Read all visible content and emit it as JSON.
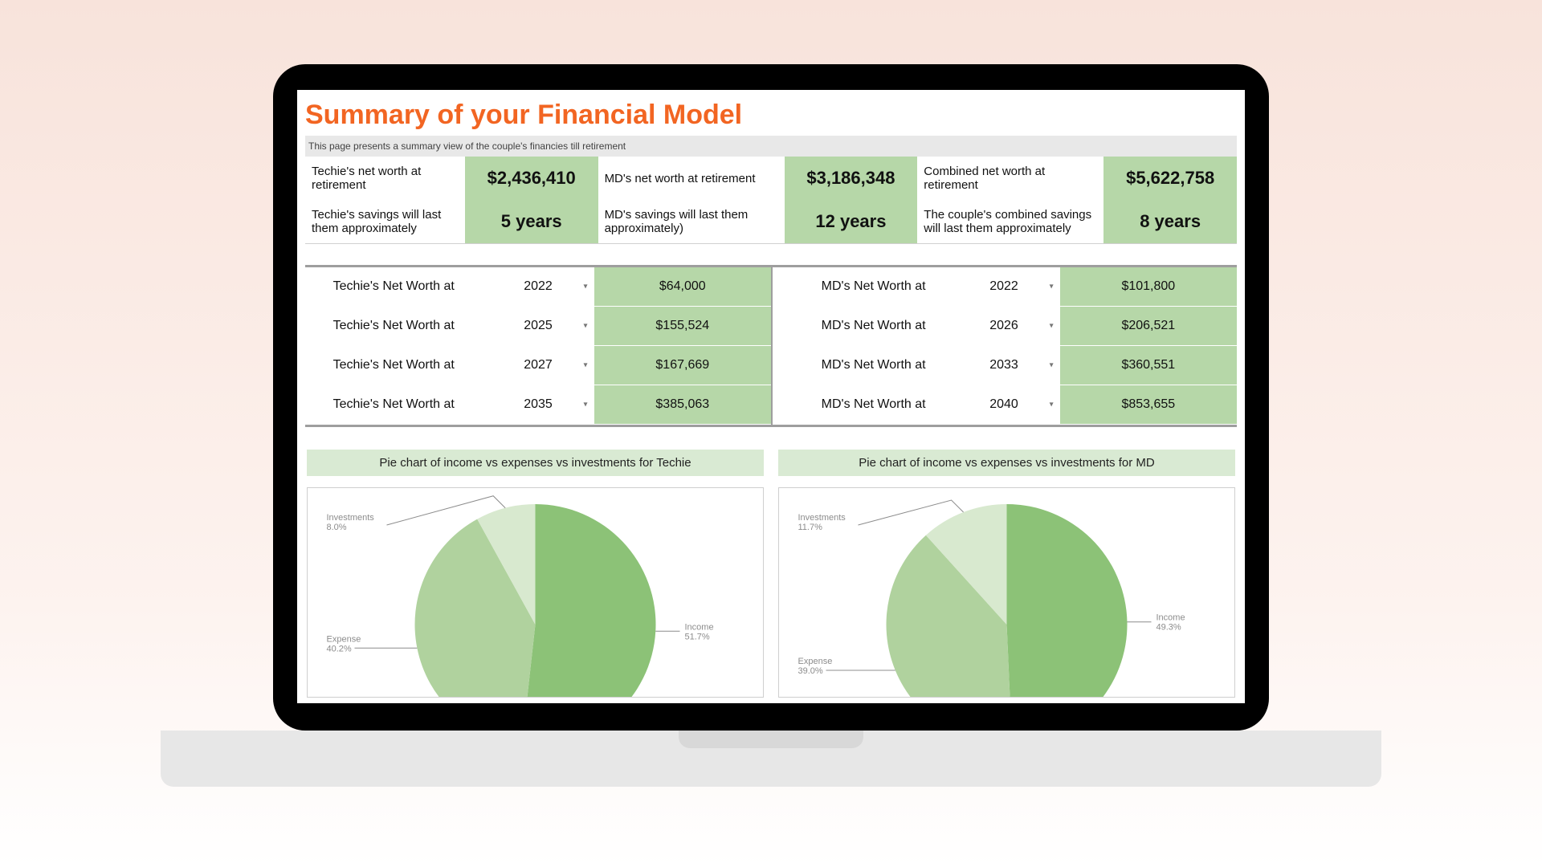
{
  "title": "Summary of your Financial Model",
  "subtitle": "This page presents a summary view of the couple's financies till retirement",
  "summary": {
    "r1": {
      "l1": "Techie's net worth at retirement",
      "v1": "$2,436,410",
      "l2": "MD's net worth at retirement",
      "v2": "$3,186,348",
      "l3": "Combined net worth at retirement",
      "v3": "$5,622,758"
    },
    "r2": {
      "l1": "Techie's savings will last them approximately",
      "v1": "5 years",
      "l2": "MD's savings will last them approximately)",
      "v2": "12 years",
      "l3": "The couple's combined savings will last them approximately",
      "v3": "8 years"
    }
  },
  "net_worth_rows": [
    {
      "left_label": "Techie's Net Worth at",
      "left_year": "2022",
      "left_amount": "$64,000",
      "right_label": "MD's Net Worth at",
      "right_year": "2022",
      "right_amount": "$101,800"
    },
    {
      "left_label": "Techie's Net Worth at",
      "left_year": "2025",
      "left_amount": "$155,524",
      "right_label": "MD's Net Worth at",
      "right_year": "2026",
      "right_amount": "$206,521"
    },
    {
      "left_label": "Techie's Net Worth at",
      "left_year": "2027",
      "left_amount": "$167,669",
      "right_label": "MD's Net Worth at",
      "right_year": "2033",
      "right_amount": "$360,551"
    },
    {
      "left_label": "Techie's Net Worth at",
      "left_year": "2035",
      "left_amount": "$385,063",
      "right_label": "MD's Net Worth at",
      "right_year": "2040",
      "right_amount": "$853,655"
    }
  ],
  "chart_left_title": "Pie chart of income vs expenses vs investments for Techie",
  "chart_right_title": "Pie chart of income vs expenses vs investments for MD",
  "chart_data": [
    {
      "type": "pie",
      "title": "Pie chart of income vs expenses vs investments for Techie",
      "series": [
        {
          "name": "Income",
          "value": 51.7,
          "label": "Income",
          "pct": "51.7%"
        },
        {
          "name": "Expense",
          "value": 40.2,
          "label": "Expense",
          "pct": "40.2%"
        },
        {
          "name": "Investments",
          "value": 8.0,
          "label": "Investments",
          "pct": "8.0%"
        }
      ],
      "colors": {
        "Income": "#8cc277",
        "Expense": "#b0d29e",
        "Investments": "#d8e9cf"
      }
    },
    {
      "type": "pie",
      "title": "Pie chart of income vs expenses vs investments for MD",
      "series": [
        {
          "name": "Income",
          "value": 49.3,
          "label": "Income",
          "pct": "49.3%"
        },
        {
          "name": "Expense",
          "value": 39.0,
          "label": "Expense",
          "pct": "39.0%"
        },
        {
          "name": "Investments",
          "value": 11.7,
          "label": "Investments",
          "pct": "11.7%"
        }
      ],
      "colors": {
        "Income": "#8cc277",
        "Expense": "#b0d29e",
        "Investments": "#d8e9cf"
      }
    }
  ]
}
